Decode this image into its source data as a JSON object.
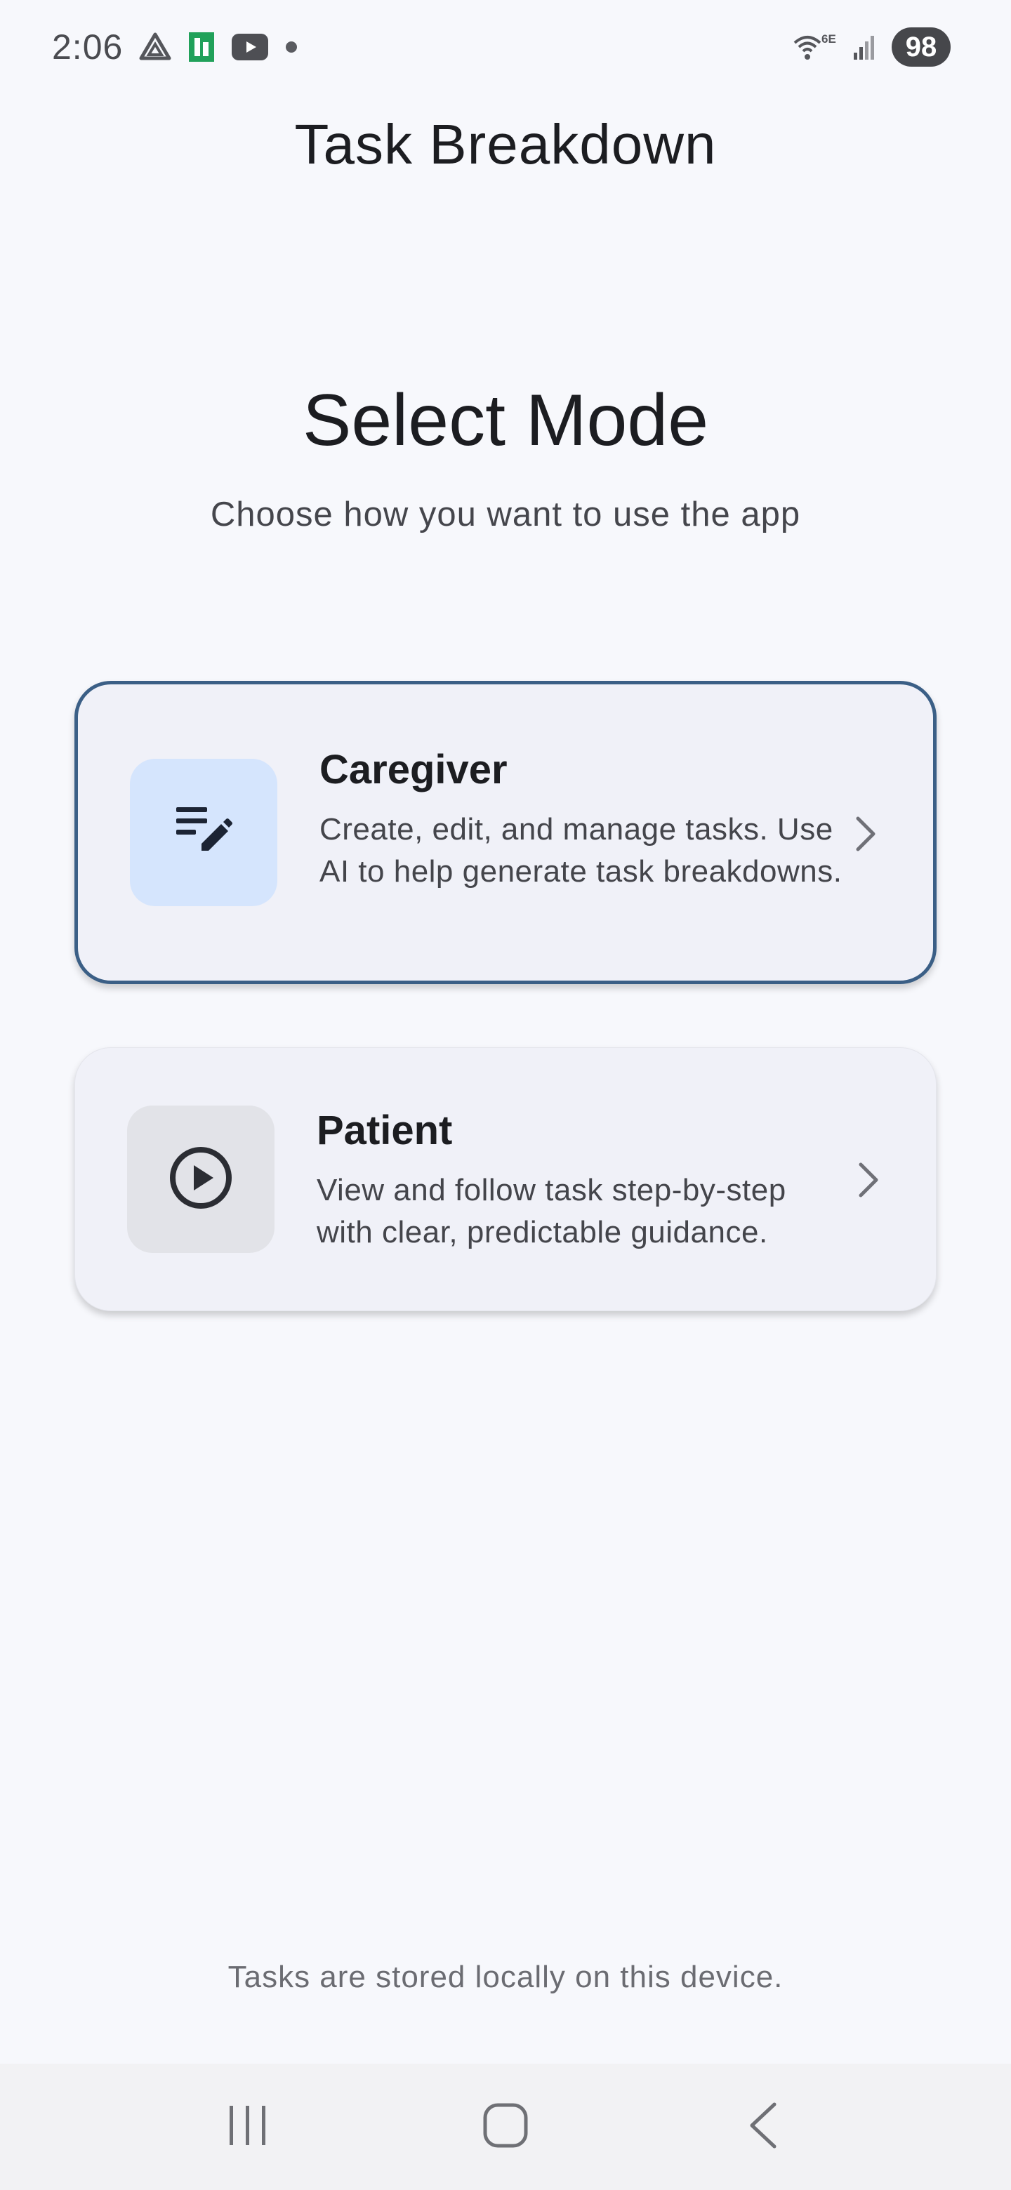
{
  "status_bar": {
    "time": "2:06",
    "battery": "98",
    "network_label": "6E",
    "icons": [
      "drive-icon",
      "sheets-icon",
      "youtube-icon",
      "notification-dot-icon",
      "wifi-icon",
      "signal-icon"
    ]
  },
  "app_bar": {
    "title": "Task Breakdown"
  },
  "main": {
    "heading": "Select Mode",
    "subheading": "Choose how you want to use the app",
    "modes": [
      {
        "title": "Caregiver",
        "description": "Create, edit, and manage tasks. Use AI to help generate task breakdowns.",
        "icon": "edit-list-icon",
        "selected": true
      },
      {
        "title": "Patient",
        "description": "View and follow task step-by-step with clear, predictable guidance.",
        "icon": "play-circle-icon",
        "selected": false
      }
    ],
    "footer_note": "Tasks are stored locally on this device."
  },
  "colors": {
    "background": "#f7f8fc",
    "card": "#f0f1f8",
    "selected_border": "#3b5f86",
    "caregiver_icon_bg": "#d5e5fd",
    "patient_icon_bg": "#e2e3e8"
  },
  "nav_bar": {
    "buttons": [
      "recent-apps-icon",
      "home-icon",
      "back-icon"
    ]
  }
}
